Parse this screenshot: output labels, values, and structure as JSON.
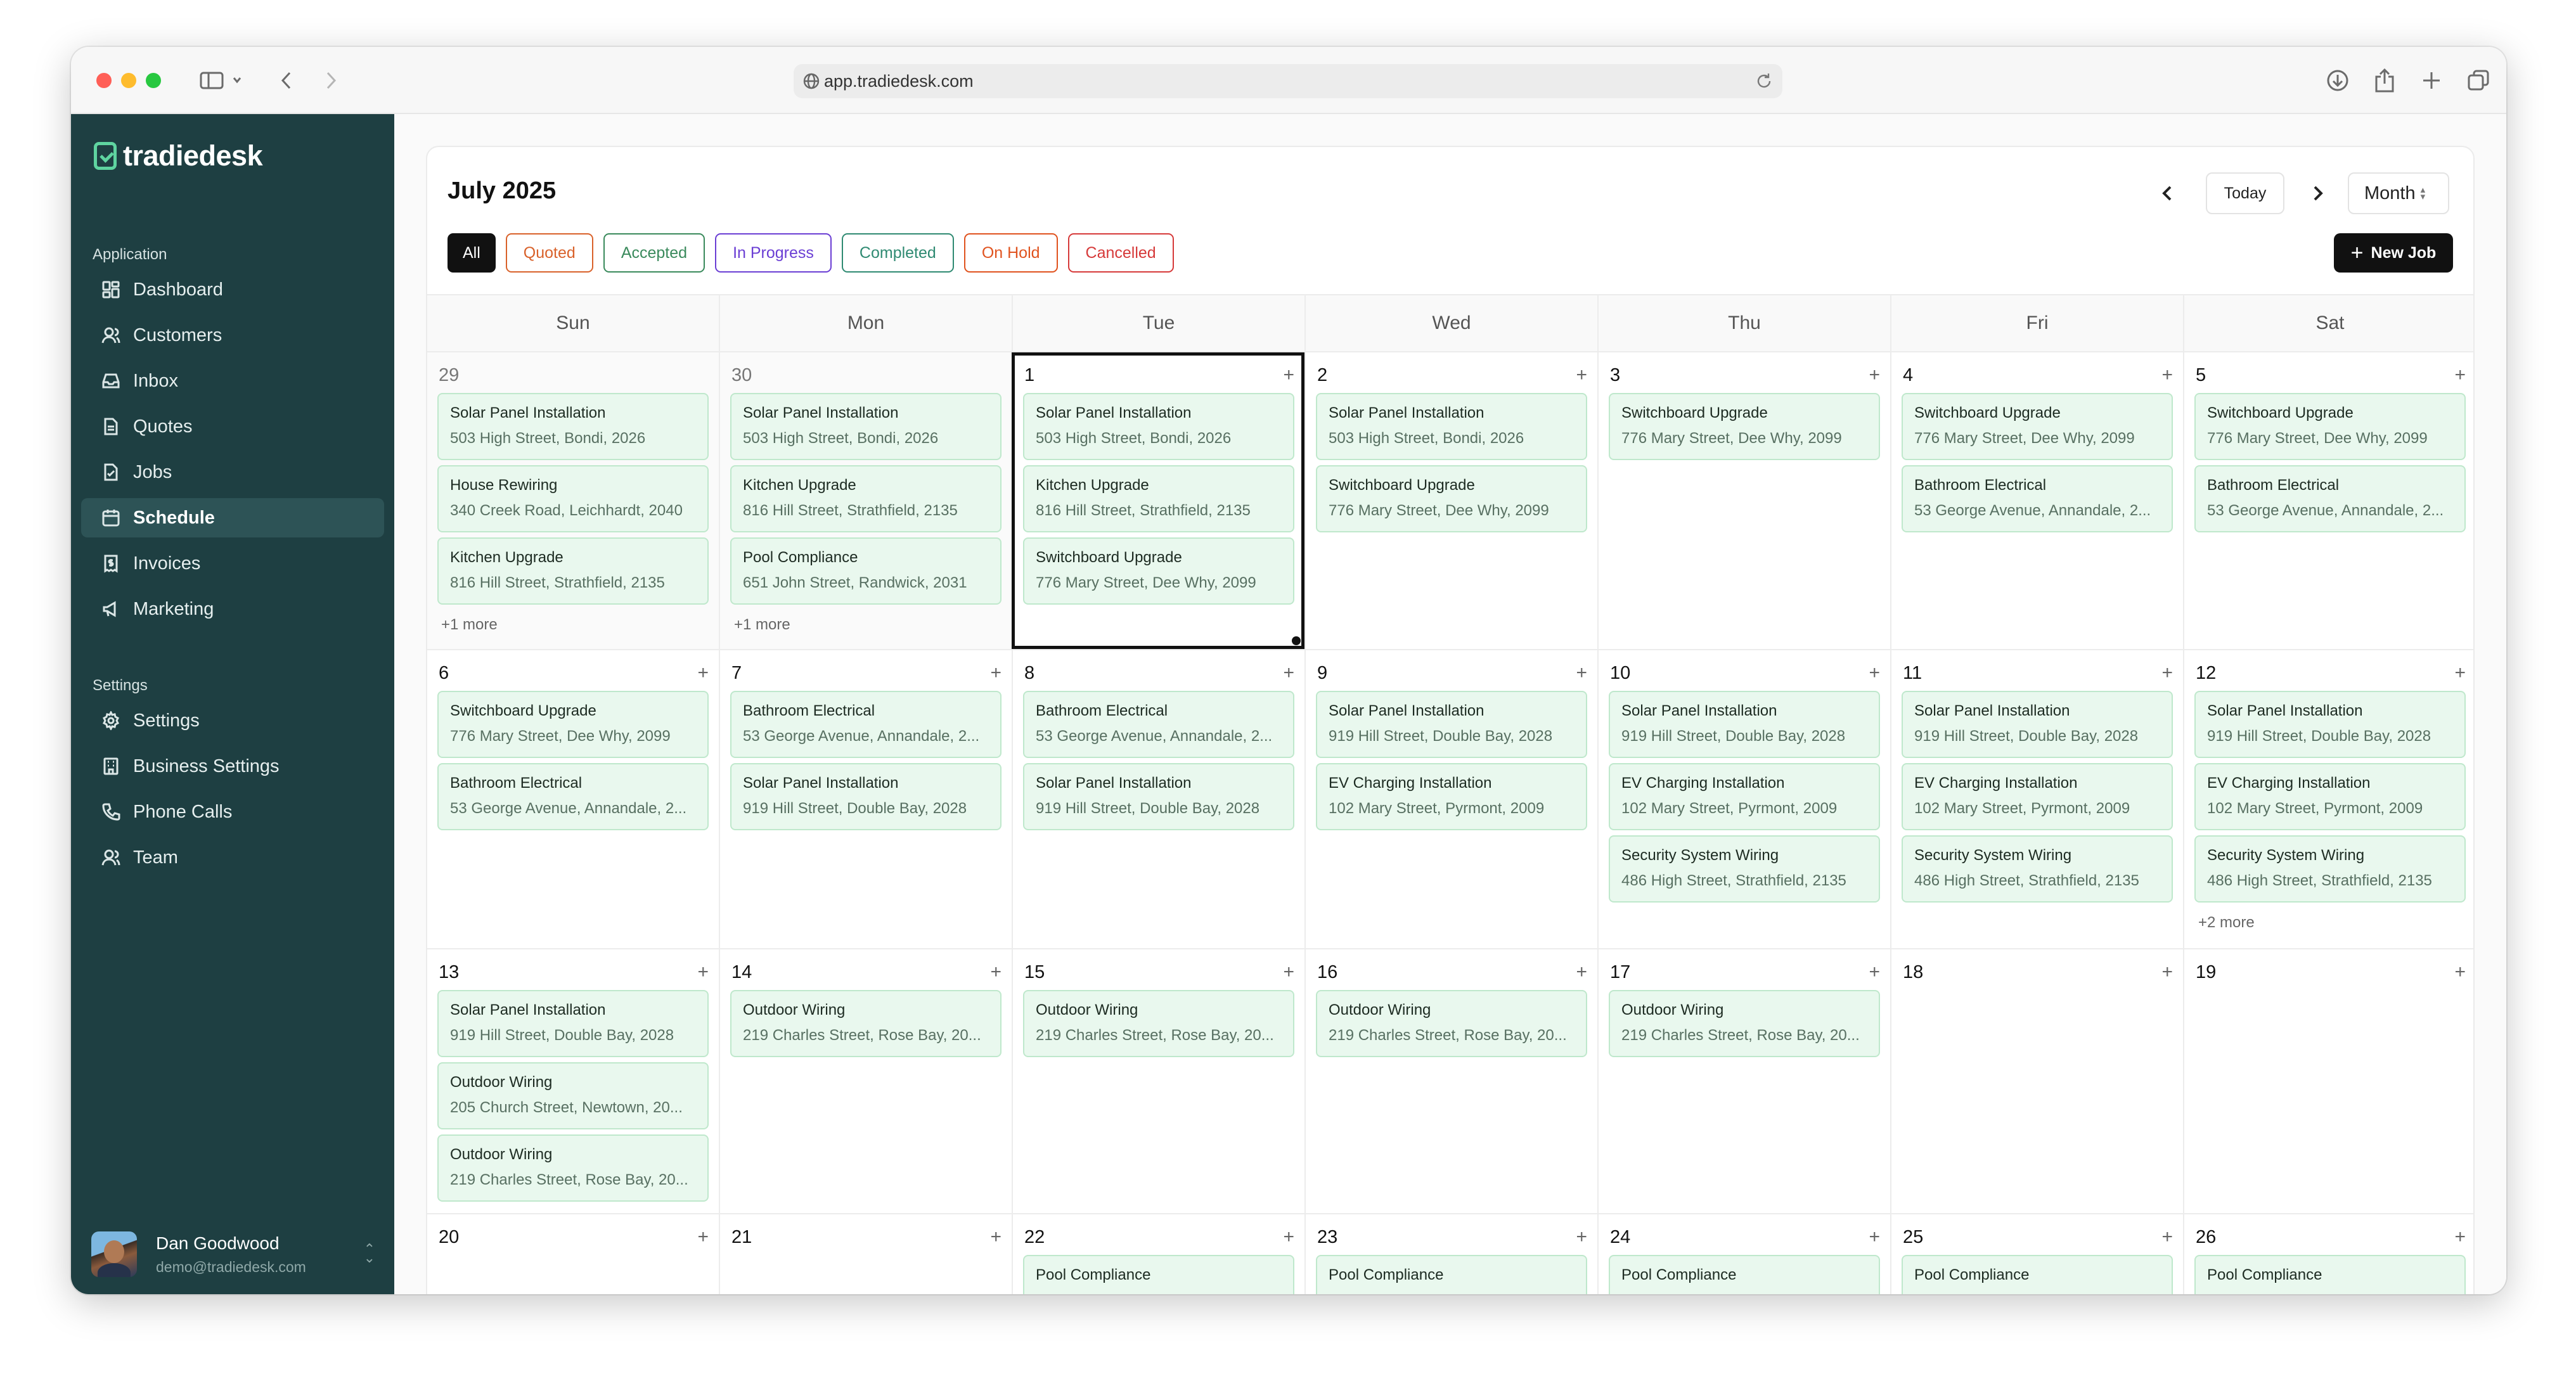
{
  "browser": {
    "url": "app.tradiedesk.com"
  },
  "sidebar": {
    "logo": "tradiedesk",
    "section_application": "Application",
    "application_items": [
      {
        "label": "Dashboard",
        "icon": "dashboard-icon"
      },
      {
        "label": "Customers",
        "icon": "customers-icon"
      },
      {
        "label": "Inbox",
        "icon": "inbox-icon"
      },
      {
        "label": "Quotes",
        "icon": "quotes-icon"
      },
      {
        "label": "Jobs",
        "icon": "jobs-icon"
      },
      {
        "label": "Schedule",
        "icon": "calendar-icon",
        "active": true
      },
      {
        "label": "Invoices",
        "icon": "invoice-icon"
      },
      {
        "label": "Marketing",
        "icon": "megaphone-icon"
      }
    ],
    "section_settings": "Settings",
    "settings_items": [
      {
        "label": "Settings",
        "icon": "gear-icon"
      },
      {
        "label": "Business Settings",
        "icon": "building-icon"
      },
      {
        "label": "Phone Calls",
        "icon": "phone-icon"
      },
      {
        "label": "Team",
        "icon": "team-icon"
      }
    ],
    "user": {
      "name": "Dan Goodwood",
      "email": "demo@tradiedesk.com"
    }
  },
  "calendar": {
    "title": "July 2025",
    "today_label": "Today",
    "view_label": "Month",
    "new_job_label": "New Job",
    "filters": [
      {
        "label": "All",
        "color": "#111111",
        "active": true
      },
      {
        "label": "Quoted",
        "color": "#d9622b"
      },
      {
        "label": "Accepted",
        "color": "#3a8a5c"
      },
      {
        "label": "In Progress",
        "color": "#6b3fd4"
      },
      {
        "label": "Completed",
        "color": "#2f8a72"
      },
      {
        "label": "On Hold",
        "color": "#e0531f"
      },
      {
        "label": "Cancelled",
        "color": "#d63a3a"
      }
    ],
    "weekdays": [
      "Sun",
      "Mon",
      "Tue",
      "Wed",
      "Thu",
      "Fri",
      "Sat"
    ],
    "weeks": [
      [
        {
          "day": "29",
          "outside": true,
          "add": false,
          "events": [
            {
              "title": "Solar Panel Installation",
              "address": "503 High Street, Bondi, 2026"
            },
            {
              "title": "House Rewiring",
              "address": "340 Creek Road, Leichhardt, 2040"
            },
            {
              "title": "Kitchen Upgrade",
              "address": "816 Hill Street, Strathfield, 2135"
            }
          ],
          "more": "+1 more"
        },
        {
          "day": "30",
          "outside": true,
          "add": false,
          "events": [
            {
              "title": "Solar Panel Installation",
              "address": "503 High Street, Bondi, 2026"
            },
            {
              "title": "Kitchen Upgrade",
              "address": "816 Hill Street, Strathfield, 2135"
            },
            {
              "title": "Pool Compliance",
              "address": "651 John Street, Randwick, 2031"
            }
          ],
          "more": "+1 more"
        },
        {
          "day": "1",
          "today": true,
          "events": [
            {
              "title": "Solar Panel Installation",
              "address": "503 High Street, Bondi, 2026"
            },
            {
              "title": "Kitchen Upgrade",
              "address": "816 Hill Street, Strathfield, 2135"
            },
            {
              "title": "Switchboard Upgrade",
              "address": "776 Mary Street, Dee Why, 2099"
            }
          ]
        },
        {
          "day": "2",
          "events": [
            {
              "title": "Solar Panel Installation",
              "address": "503 High Street, Bondi, 2026"
            },
            {
              "title": "Switchboard Upgrade",
              "address": "776 Mary Street, Dee Why, 2099"
            }
          ]
        },
        {
          "day": "3",
          "events": [
            {
              "title": "Switchboard Upgrade",
              "address": "776 Mary Street, Dee Why, 2099"
            }
          ]
        },
        {
          "day": "4",
          "events": [
            {
              "title": "Switchboard Upgrade",
              "address": "776 Mary Street, Dee Why, 2099"
            },
            {
              "title": "Bathroom Electrical",
              "address": "53 George Avenue, Annandale, 2..."
            }
          ]
        },
        {
          "day": "5",
          "events": [
            {
              "title": "Switchboard Upgrade",
              "address": "776 Mary Street, Dee Why, 2099"
            },
            {
              "title": "Bathroom Electrical",
              "address": "53 George Avenue, Annandale, 2..."
            }
          ]
        }
      ],
      [
        {
          "day": "6",
          "events": [
            {
              "title": "Switchboard Upgrade",
              "address": "776 Mary Street, Dee Why, 2099"
            },
            {
              "title": "Bathroom Electrical",
              "address": "53 George Avenue, Annandale, 2..."
            }
          ]
        },
        {
          "day": "7",
          "events": [
            {
              "title": "Bathroom Electrical",
              "address": "53 George Avenue, Annandale, 2..."
            },
            {
              "title": "Solar Panel Installation",
              "address": "919 Hill Street, Double Bay, 2028"
            }
          ]
        },
        {
          "day": "8",
          "events": [
            {
              "title": "Bathroom Electrical",
              "address": "53 George Avenue, Annandale, 2..."
            },
            {
              "title": "Solar Panel Installation",
              "address": "919 Hill Street, Double Bay, 2028"
            }
          ]
        },
        {
          "day": "9",
          "events": [
            {
              "title": "Solar Panel Installation",
              "address": "919 Hill Street, Double Bay, 2028"
            },
            {
              "title": "EV Charging Installation",
              "address": "102 Mary Street, Pyrmont, 2009"
            }
          ]
        },
        {
          "day": "10",
          "events": [
            {
              "title": "Solar Panel Installation",
              "address": "919 Hill Street, Double Bay, 2028"
            },
            {
              "title": "EV Charging Installation",
              "address": "102 Mary Street, Pyrmont, 2009"
            },
            {
              "title": "Security System Wiring",
              "address": "486 High Street, Strathfield, 2135"
            }
          ]
        },
        {
          "day": "11",
          "events": [
            {
              "title": "Solar Panel Installation",
              "address": "919 Hill Street, Double Bay, 2028"
            },
            {
              "title": "EV Charging Installation",
              "address": "102 Mary Street, Pyrmont, 2009"
            },
            {
              "title": "Security System Wiring",
              "address": "486 High Street, Strathfield, 2135"
            }
          ]
        },
        {
          "day": "12",
          "events": [
            {
              "title": "Solar Panel Installation",
              "address": "919 Hill Street, Double Bay, 2028"
            },
            {
              "title": "EV Charging Installation",
              "address": "102 Mary Street, Pyrmont, 2009"
            },
            {
              "title": "Security System Wiring",
              "address": "486 High Street, Strathfield, 2135"
            }
          ],
          "more": "+2 more"
        }
      ],
      [
        {
          "day": "13",
          "events": [
            {
              "title": "Solar Panel Installation",
              "address": "919 Hill Street, Double Bay, 2028"
            },
            {
              "title": "Outdoor Wiring",
              "address": "205 Church Street, Newtown, 20..."
            },
            {
              "title": "Outdoor Wiring",
              "address": "219 Charles Street, Rose Bay, 20..."
            }
          ]
        },
        {
          "day": "14",
          "events": [
            {
              "title": "Outdoor Wiring",
              "address": "219 Charles Street, Rose Bay, 20..."
            }
          ]
        },
        {
          "day": "15",
          "events": [
            {
              "title": "Outdoor Wiring",
              "address": "219 Charles Street, Rose Bay, 20..."
            }
          ]
        },
        {
          "day": "16",
          "events": [
            {
              "title": "Outdoor Wiring",
              "address": "219 Charles Street, Rose Bay, 20..."
            }
          ]
        },
        {
          "day": "17",
          "events": [
            {
              "title": "Outdoor Wiring",
              "address": "219 Charles Street, Rose Bay, 20..."
            }
          ]
        },
        {
          "day": "18",
          "events": []
        },
        {
          "day": "19",
          "events": []
        }
      ],
      [
        {
          "day": "20",
          "events": []
        },
        {
          "day": "21",
          "events": []
        },
        {
          "day": "22",
          "events": [
            {
              "title": "Pool Compliance",
              "address": ""
            }
          ]
        },
        {
          "day": "23",
          "events": [
            {
              "title": "Pool Compliance",
              "address": ""
            }
          ]
        },
        {
          "day": "24",
          "events": [
            {
              "title": "Pool Compliance",
              "address": ""
            }
          ]
        },
        {
          "day": "25",
          "events": [
            {
              "title": "Pool Compliance",
              "address": ""
            }
          ]
        },
        {
          "day": "26",
          "events": [
            {
              "title": "Pool Compliance",
              "address": ""
            }
          ]
        }
      ]
    ]
  }
}
